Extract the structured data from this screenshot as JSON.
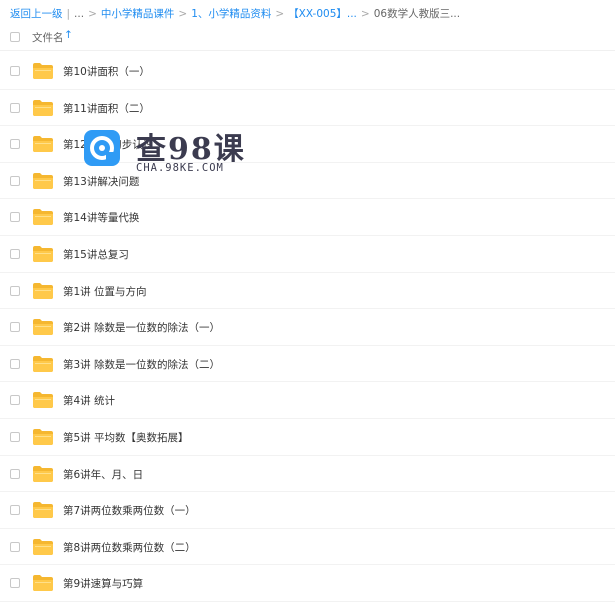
{
  "breadcrumb": [
    {
      "label": "返回上一级",
      "link": true
    },
    {
      "label": "|",
      "link": false
    },
    {
      "label": "...",
      "link": false
    },
    {
      "label": ">",
      "link": false
    },
    {
      "label": "中小学精品课件",
      "link": true
    },
    {
      "label": ">",
      "link": false
    },
    {
      "label": "1、小学精品资料",
      "link": true
    },
    {
      "label": ">",
      "link": false
    },
    {
      "label": "【XX-005】...",
      "link": true
    },
    {
      "label": ">",
      "link": false
    },
    {
      "label": "06数学人教版三...",
      "link": false
    }
  ],
  "header": {
    "column_label": "文件名",
    "sort_icon": "↑"
  },
  "files": [
    {
      "name": "第10讲面积（一）"
    },
    {
      "name": "第11讲面积（二）"
    },
    {
      "name": "第12讲  的初步认识"
    },
    {
      "name": "第13讲解决问题"
    },
    {
      "name": "第14讲等量代换"
    },
    {
      "name": "第15讲总复习"
    },
    {
      "name": "第1讲 位置与方向"
    },
    {
      "name": "第2讲 除数是一位数的除法（一）"
    },
    {
      "name": "第3讲 除数是一位数的除法（二）"
    },
    {
      "name": "第4讲 统计"
    },
    {
      "name": "第5讲 平均数【奥数拓展】"
    },
    {
      "name": "第6讲年、月、日"
    },
    {
      "name": "第7讲两位数乘两位数（一）"
    },
    {
      "name": "第8讲两位数乘两位数（二）"
    },
    {
      "name": "第9讲速算与巧算"
    }
  ],
  "watermark": {
    "title": "查98课",
    "subtitle": "CHA.98KE.COM"
  },
  "colors": {
    "link": "#1f8cf0",
    "folder": "#ffc94a",
    "folder_tab": "#f5b730",
    "watermark_logo": "#2f9bf5"
  },
  "icons": {
    "folder": "folder-icon",
    "checkbox": "checkbox",
    "sort": "sort-arrow-up-icon",
    "logo": "chat-logo-icon"
  }
}
